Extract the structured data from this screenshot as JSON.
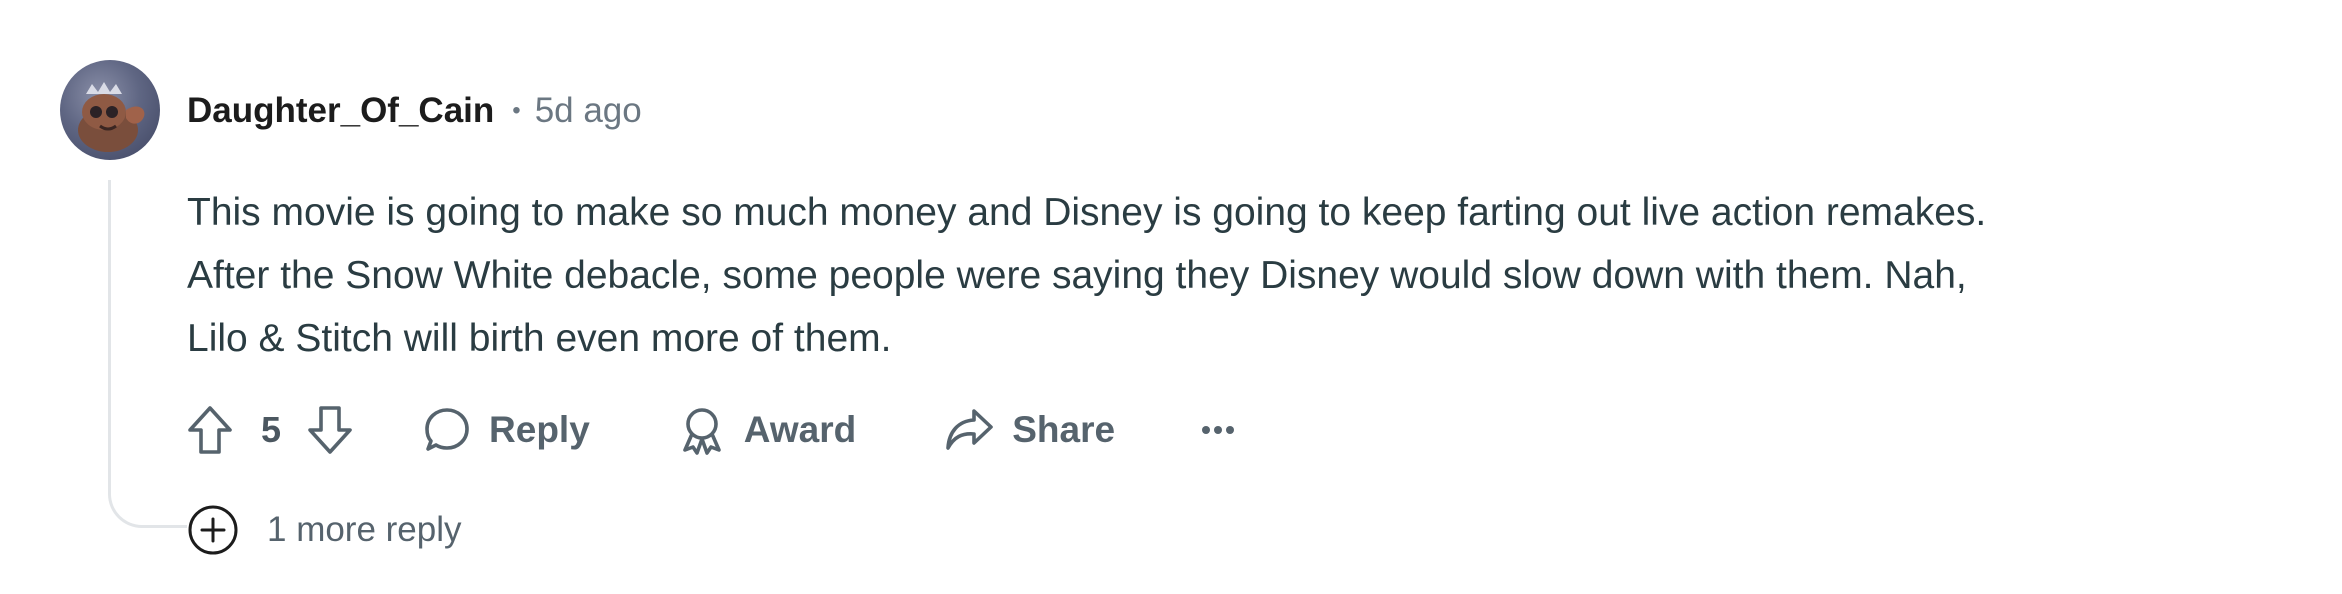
{
  "comment": {
    "author": "Daughter_Of_Cain",
    "separator": "•",
    "time_ago": "5d ago",
    "avatar_icon": "avatar-icon",
    "body_lines": [
      "This movie is going to make so much money and Disney is going to keep farting out live action remakes.",
      "After the Snow White debacle, some people were saying they Disney would slow down with them. Nah,",
      "Lilo & Stitch will birth even more of them."
    ]
  },
  "actions": {
    "upvote_icon": "arrow-up-icon",
    "vote_count": "5",
    "downvote_icon": "arrow-down-icon",
    "reply_icon": "speech-bubble-icon",
    "reply_label": "Reply",
    "award_icon": "award-icon",
    "award_label": "Award",
    "share_icon": "share-arrow-icon",
    "share_label": "Share",
    "more_icon": "ellipsis-icon"
  },
  "more_replies": {
    "icon": "plus-circle-icon",
    "label": "1 more reply"
  },
  "colors": {
    "text_primary": "#1c1c1c",
    "text_body": "#2a3c42",
    "text_secondary": "#56636d",
    "thread_line": "#e2e5e8"
  }
}
